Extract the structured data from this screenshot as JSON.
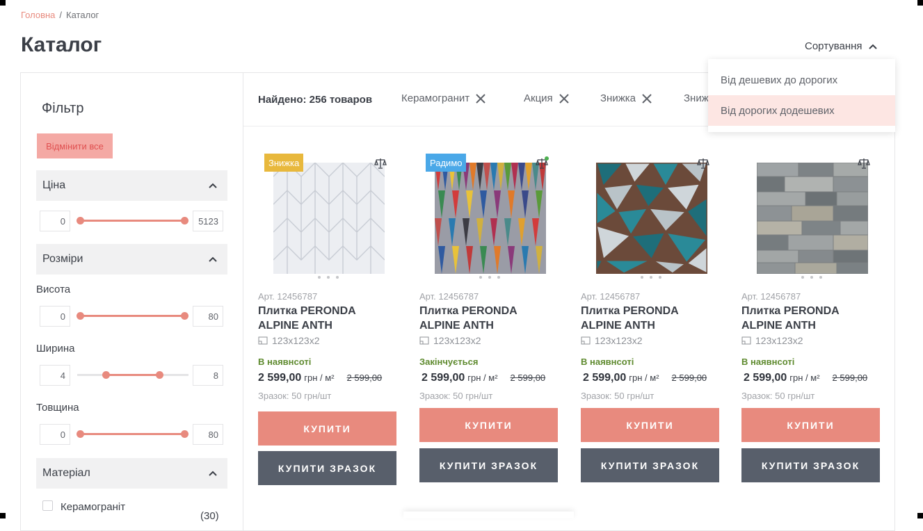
{
  "breadcrumb": {
    "home": "Головна",
    "separator": "/",
    "current": "Каталог"
  },
  "page_title": "Каталог",
  "sort": {
    "label": "Сортування",
    "options": [
      "Від дешевих до дорогих",
      "Від дорогих додешевих"
    ],
    "active_index": 1
  },
  "filter": {
    "title": "Фільтр",
    "reset_label": "Відмінити все",
    "sections": {
      "price": {
        "title": "Ціна",
        "min": "0",
        "max": "5123"
      },
      "sizes": {
        "title": "Розміри"
      },
      "height": {
        "label": "Висота",
        "min": "0",
        "max": "80"
      },
      "width": {
        "label": "Ширина",
        "min": "4",
        "max": "8"
      },
      "thickness": {
        "label": "Товщина",
        "min": "0",
        "max": "80"
      },
      "material": {
        "title": "Матеріал",
        "options": [
          {
            "label": "Керамограніт",
            "count": "(30)"
          }
        ]
      }
    }
  },
  "results": {
    "found_label": "Найдено: 256 товаров",
    "chips": [
      "Керамогранит",
      "Акция",
      "Знижка",
      "Зниж"
    ]
  },
  "products": [
    {
      "badge": "Знижка",
      "badge_color": "#e8b83c",
      "art": "Арт. 12456787",
      "name_line1": "Плитка PERONDA",
      "name_line2": "ALPINE ANTH",
      "dims": "123х123х2",
      "stock": "В наявнсоті",
      "price": "2 599,00",
      "unit": "грн / м²",
      "old_price": "2 599,00",
      "sample": "Зразок: 50 грн/шт",
      "buy": "КУПИТИ",
      "buy_sample": "КУПИТИ ЗРАЗОК",
      "compare_active": false
    },
    {
      "badge": "Радимо",
      "badge_color": "#4aa8e8",
      "art": "Арт. 12456787",
      "name_line1": "Плитка PERONDA",
      "name_line2": "ALPINE ANTH",
      "dims": "123х123х2",
      "stock": "Закінчується",
      "price": "2 599,00",
      "unit": "грн / м²",
      "old_price": "2 599,00",
      "sample": "Зразок: 50 грн/шт",
      "buy": "КУПИТИ",
      "buy_sample": "КУПИТИ ЗРАЗОК",
      "compare_active": true
    },
    {
      "badge": "",
      "badge_color": "",
      "art": "Арт. 12456787",
      "name_line1": "Плитка PERONDA",
      "name_line2": "ALPINE ANTH",
      "dims": "123х123х2",
      "stock": "В наявнсоті",
      "price": "2 599,00",
      "unit": "грн / м²",
      "old_price": "2 599,00",
      "sample": "Зразок: 50 грн/шт",
      "buy": "КУПИТИ",
      "buy_sample": "КУПИТИ ЗРАЗОК",
      "compare_active": false
    },
    {
      "badge": "",
      "badge_color": "",
      "art": "Арт. 12456787",
      "name_line1": "Плитка PERONDA",
      "name_line2": "ALPINE ANTH",
      "dims": "123х123х2",
      "stock": "В наявнсоті",
      "price": "2 599,00",
      "unit": "грн / м²",
      "old_price": "2 599,00",
      "sample": "Зразок: 50 грн/шт",
      "buy": "КУПИТИ",
      "buy_sample": "КУПИТИ ЗРАЗОК",
      "compare_active": false
    }
  ],
  "icons": {
    "sort_chevron": "chevron-up-icon",
    "accordion_chevron": "chevron-up-icon",
    "chip_close": "close-icon",
    "compare": "scales-icon",
    "dims": "size-icon"
  },
  "colors": {
    "accent": "#e88a7e",
    "dark_button": "#585f6b",
    "stock_green": "#5e8a2e",
    "reset_bg": "#f4a9a4",
    "dropdown_highlight": "#fde6e3"
  }
}
